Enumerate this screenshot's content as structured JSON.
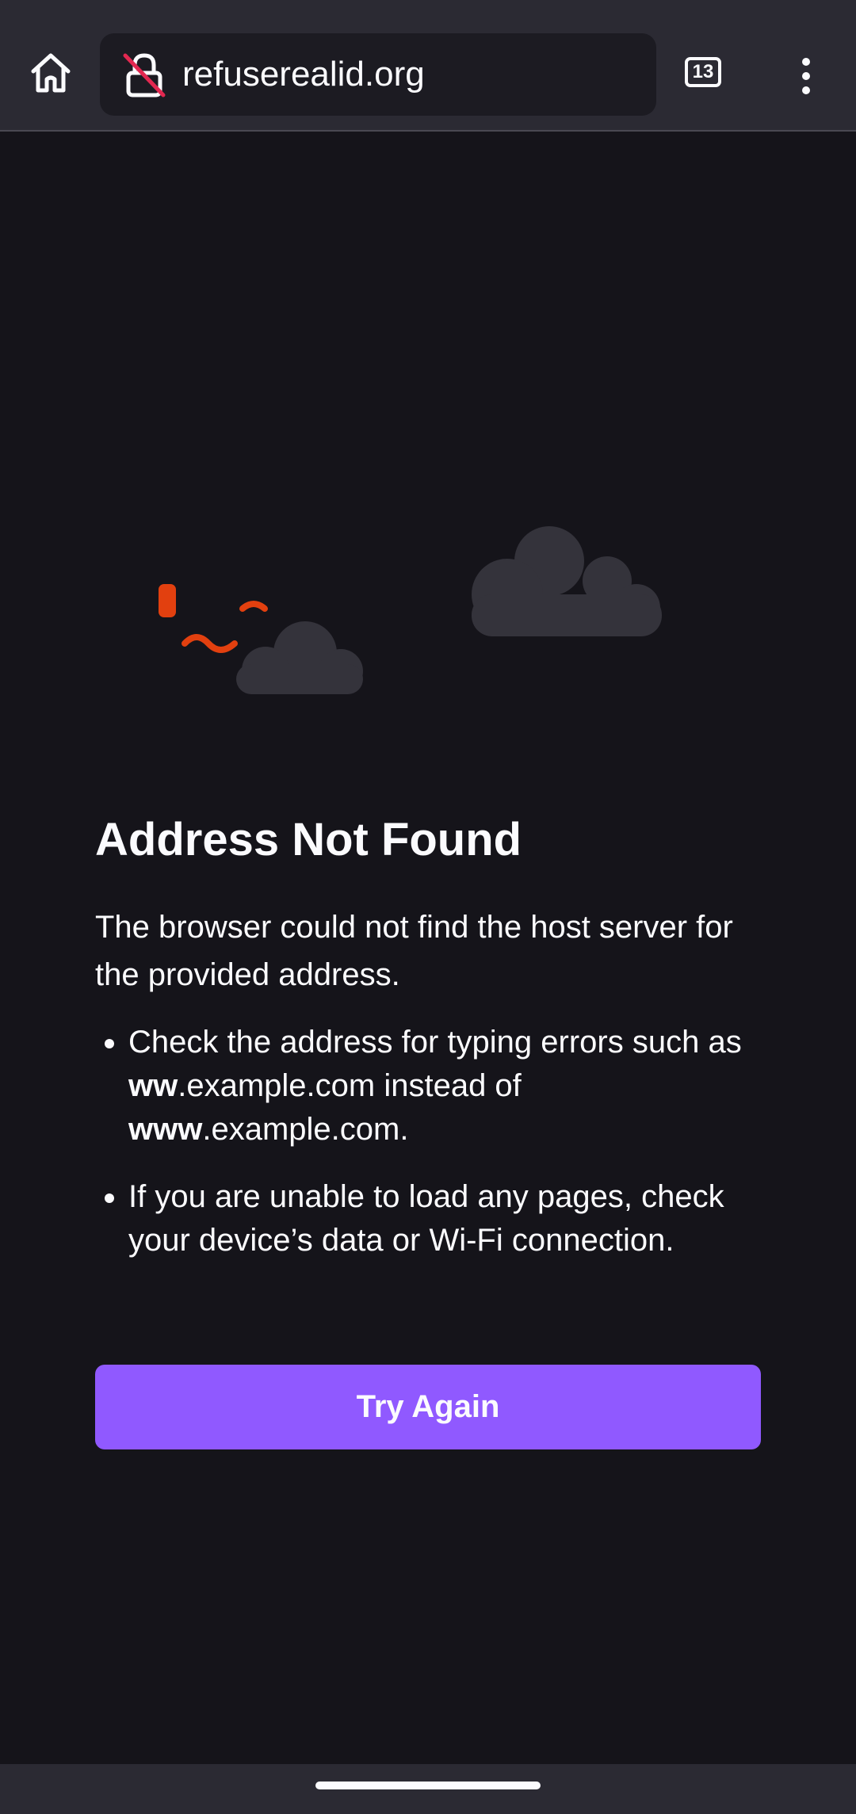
{
  "toolbar": {
    "url": "refuserealid.org",
    "tab_count": "13"
  },
  "error": {
    "title": "Address Not Found",
    "description": "The browser could not find the host server for the provided address.",
    "tip1": {
      "part1": "Check the address for typing errors such as ",
      "bold1": "ww",
      "part2": ".example.com instead of ",
      "bold2": "www",
      "part3": ".example.com."
    },
    "tip2": "If you are unable to load any pages, check your device’s data or Wi-Fi connection.",
    "button_label": "Try Again"
  },
  "colors": {
    "accent": "#9059ff",
    "toolbar": "#2b2a33",
    "background": "#15141a",
    "dino": "#e2400f",
    "cloud": "#34333b"
  },
  "icons": [
    "home-icon",
    "insecure-lock-icon",
    "tabs-counter-icon",
    "kebab-menu-icon"
  ]
}
